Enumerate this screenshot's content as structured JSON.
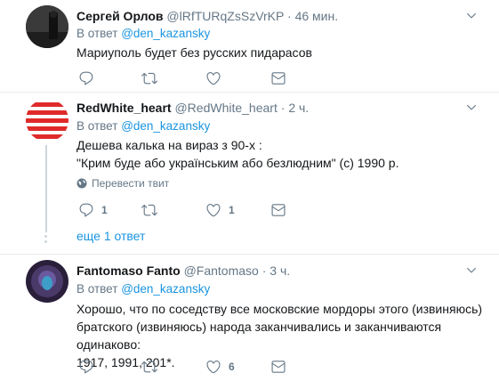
{
  "tweets": [
    {
      "name": "Сергей Орлов",
      "handle": "@lRfTURqZsSzVrKP",
      "dot": "·",
      "time": "46 мин.",
      "reply_prefix": "В ответ",
      "reply_to": "@den_kazansky",
      "text": "Мариуполь будет без русских пидарасов",
      "replies": "",
      "retweets": "",
      "likes": ""
    },
    {
      "name": "RedWhite_heart",
      "handle": "@RedWhite_heart",
      "dot": "·",
      "time": "2 ч.",
      "reply_prefix": "В ответ",
      "reply_to": "@den_kazansky",
      "text_line1": "Дешева калька на вираз з 90-х :",
      "text_line2": "\"Крим буде або українським або безлюдним\" (с) 1990 р.",
      "translate_label": "Перевести твит",
      "replies": "1",
      "retweets": "",
      "likes": "1",
      "more_replies": "еще 1 ответ"
    },
    {
      "name": "Fantomaso Fanto",
      "handle": "@Fantomaso",
      "dot": "·",
      "time": "3 ч.",
      "reply_prefix": "В ответ",
      "reply_to": "@den_kazansky",
      "text_line1": "Хорошо, что по соседству все московские мордоры этого (извиняюсь)",
      "text_line2": "братского (извиняюсь) народа заканчивались и заканчиваются одинаково:",
      "text_line3": "1917, 1991, 201*.",
      "replies": "",
      "retweets": "",
      "likes": "6"
    }
  ],
  "colors": {
    "link": "#1b95e0",
    "muted": "#657786",
    "divider": "#e6ecf0",
    "thread": "#ccd6dd"
  },
  "icons": [
    "caret-down-icon",
    "reply-icon",
    "retweet-icon",
    "like-icon",
    "message-icon",
    "globe-icon"
  ]
}
